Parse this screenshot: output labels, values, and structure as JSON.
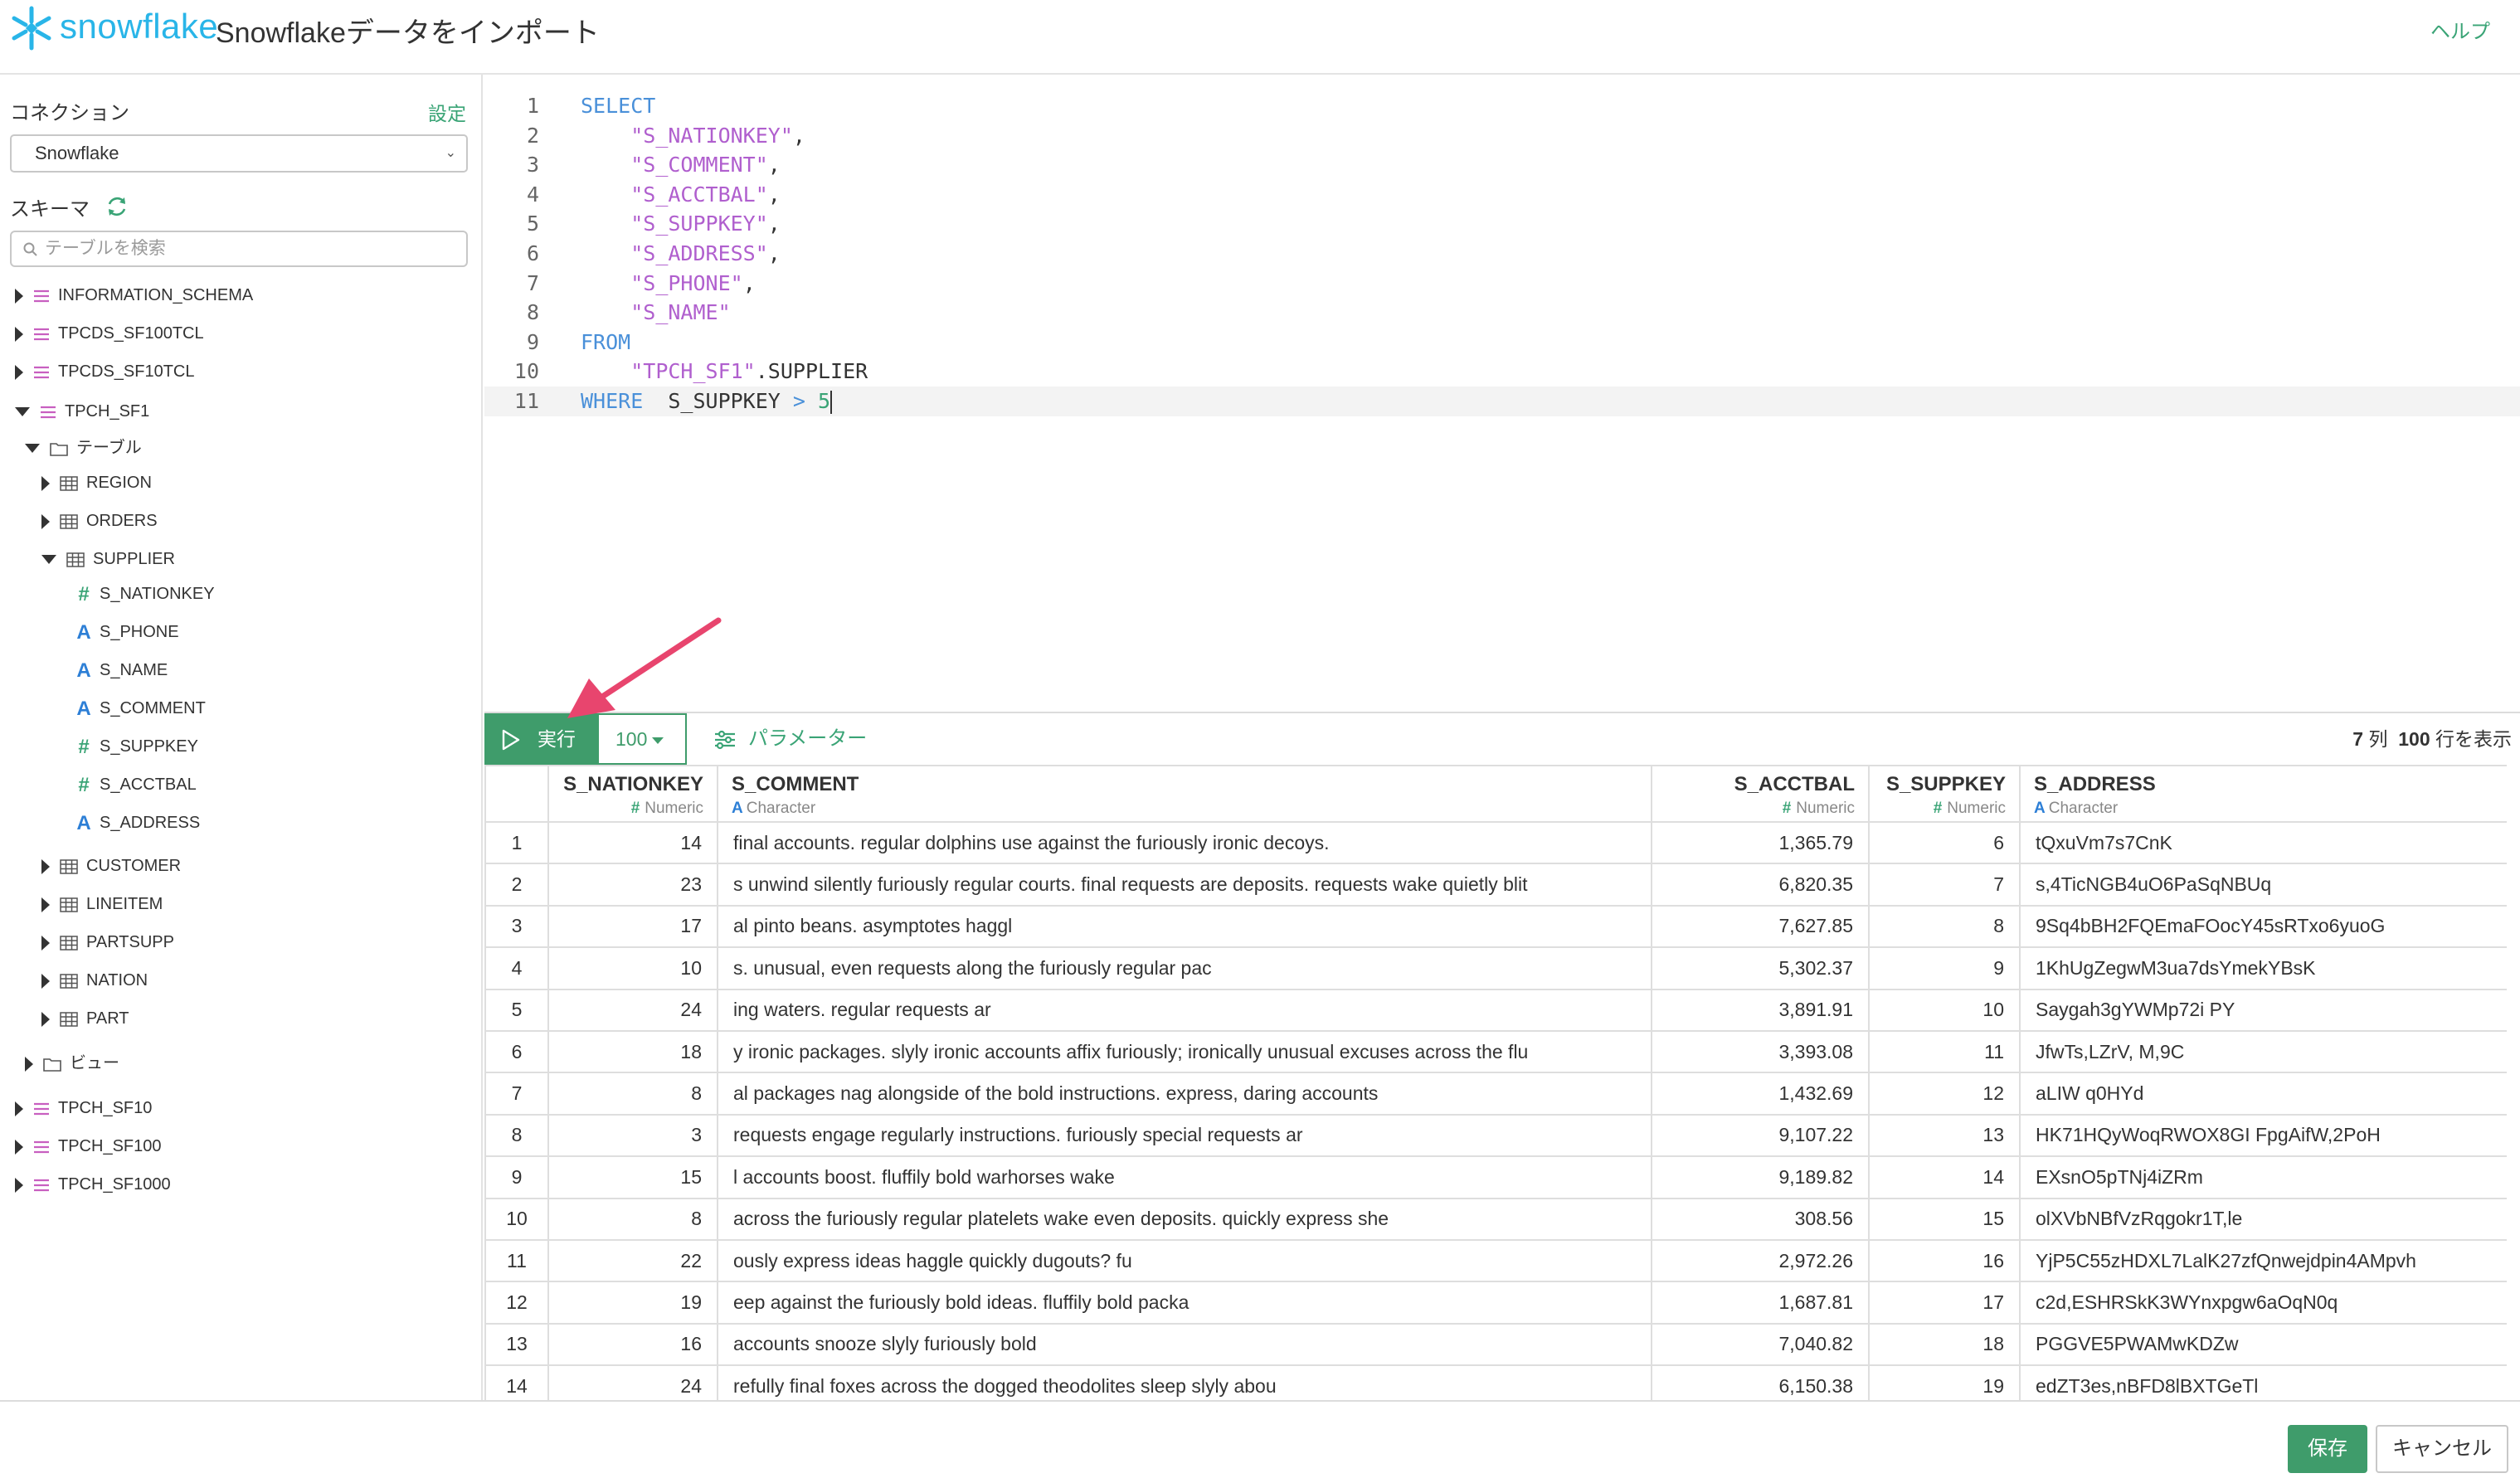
{
  "header": {
    "logo_text": "snowflake",
    "page_title": "Snowflakeデータをインポート",
    "help_label": "ヘルプ"
  },
  "sidebar": {
    "connection_label": "コネクション",
    "settings_label": "設定",
    "connection_value": "Snowflake",
    "schema_label": "スキーマ",
    "search_placeholder": "テーブルを検索",
    "tree": [
      {
        "label": "INFORMATION_SCHEMA",
        "kind": "schema",
        "expanded": false
      },
      {
        "label": "TPCDS_SF100TCL",
        "kind": "schema",
        "expanded": false
      },
      {
        "label": "TPCDS_SF10TCL",
        "kind": "schema",
        "expanded": false
      },
      {
        "label": "TPCH_SF1",
        "kind": "schema",
        "expanded": true
      },
      {
        "label": "テーブル",
        "kind": "folder",
        "expanded": true
      },
      {
        "label": "REGION",
        "kind": "table",
        "expanded": false
      },
      {
        "label": "ORDERS",
        "kind": "table",
        "expanded": false
      },
      {
        "label": "SUPPLIER",
        "kind": "table",
        "expanded": true
      },
      {
        "label": "S_NATIONKEY",
        "kind": "numeric"
      },
      {
        "label": "S_PHONE",
        "kind": "character"
      },
      {
        "label": "S_NAME",
        "kind": "character"
      },
      {
        "label": "S_COMMENT",
        "kind": "character"
      },
      {
        "label": "S_SUPPKEY",
        "kind": "numeric"
      },
      {
        "label": "S_ACCTBAL",
        "kind": "numeric"
      },
      {
        "label": "S_ADDRESS",
        "kind": "character"
      },
      {
        "label": "CUSTOMER",
        "kind": "table",
        "expanded": false
      },
      {
        "label": "LINEITEM",
        "kind": "table",
        "expanded": false
      },
      {
        "label": "PARTSUPP",
        "kind": "table",
        "expanded": false
      },
      {
        "label": "NATION",
        "kind": "table",
        "expanded": false
      },
      {
        "label": "PART",
        "kind": "table",
        "expanded": false
      },
      {
        "label": "ビュー",
        "kind": "folder",
        "expanded": false
      },
      {
        "label": "TPCH_SF10",
        "kind": "schema",
        "expanded": false
      },
      {
        "label": "TPCH_SF100",
        "kind": "schema",
        "expanded": false
      },
      {
        "label": "TPCH_SF1000",
        "kind": "schema",
        "expanded": false
      }
    ]
  },
  "editor": {
    "line_numbers": [
      "1",
      "2",
      "3",
      "4",
      "5",
      "6",
      "7",
      "8",
      "9",
      "10",
      "11"
    ],
    "lines": [
      [
        {
          "t": "SELECT",
          "c": "kw"
        }
      ],
      [
        {
          "t": "    ",
          "c": ""
        },
        {
          "t": "\"S_NATIONKEY\"",
          "c": "str"
        },
        {
          "t": ",",
          "c": ""
        }
      ],
      [
        {
          "t": "    ",
          "c": ""
        },
        {
          "t": "\"S_COMMENT\"",
          "c": "str"
        },
        {
          "t": ",",
          "c": ""
        }
      ],
      [
        {
          "t": "    ",
          "c": ""
        },
        {
          "t": "\"S_ACCTBAL\"",
          "c": "str"
        },
        {
          "t": ",",
          "c": ""
        }
      ],
      [
        {
          "t": "    ",
          "c": ""
        },
        {
          "t": "\"S_SUPPKEY\"",
          "c": "str"
        },
        {
          "t": ",",
          "c": ""
        }
      ],
      [
        {
          "t": "    ",
          "c": ""
        },
        {
          "t": "\"S_ADDRESS\"",
          "c": "str"
        },
        {
          "t": ",",
          "c": ""
        }
      ],
      [
        {
          "t": "    ",
          "c": ""
        },
        {
          "t": "\"S_PHONE\"",
          "c": "str"
        },
        {
          "t": ",",
          "c": ""
        }
      ],
      [
        {
          "t": "    ",
          "c": ""
        },
        {
          "t": "\"S_NAME\"",
          "c": "str"
        }
      ],
      [
        {
          "t": "FROM",
          "c": "kw"
        }
      ],
      [
        {
          "t": "    ",
          "c": ""
        },
        {
          "t": "\"TPCH_SF1\"",
          "c": "str"
        },
        {
          "t": ".SUPPLIER",
          "c": ""
        }
      ],
      [
        {
          "t": "WHERE",
          "c": "kw"
        },
        {
          "t": "  S_SUPPKEY ",
          "c": ""
        },
        {
          "t": ">",
          "c": "op"
        },
        {
          "t": " ",
          "c": ""
        },
        {
          "t": "5",
          "c": "num"
        }
      ]
    ]
  },
  "toolbar": {
    "run_label": "実行",
    "limit_value": "100",
    "params_label": "パラメーター",
    "col_count": "7",
    "col_unit": "列",
    "row_count": "100",
    "row_unit": "行を表示"
  },
  "results": {
    "columns": [
      {
        "name": "S_NATIONKEY",
        "type": "Numeric",
        "align": "right"
      },
      {
        "name": "S_COMMENT",
        "type": "Character",
        "align": "left"
      },
      {
        "name": "S_ACCTBAL",
        "type": "Numeric",
        "align": "right"
      },
      {
        "name": "S_SUPPKEY",
        "type": "Numeric",
        "align": "right"
      },
      {
        "name": "S_ADDRESS",
        "type": "Character",
        "align": "left"
      }
    ],
    "rows": [
      [
        "1",
        "14",
        "final accounts. regular dolphins use against the furiously ironic decoys.",
        "1,365.79",
        "6",
        "tQxuVm7s7CnK"
      ],
      [
        "2",
        "23",
        "s unwind silently furiously regular courts. final requests are deposits. requests wake quietly blit",
        "6,820.35",
        "7",
        "s,4TicNGB4uO6PaSqNBUq"
      ],
      [
        "3",
        "17",
        "al pinto beans. asymptotes haggl",
        "7,627.85",
        "8",
        "9Sq4bBH2FQEmaFOocY45sRTxo6yuoG"
      ],
      [
        "4",
        "10",
        "s. unusual, even requests along the furiously regular pac",
        "5,302.37",
        "9",
        "1KhUgZegwM3ua7dsYmekYBsK"
      ],
      [
        "5",
        "24",
        "ing waters. regular requests ar",
        "3,891.91",
        "10",
        "Saygah3gYWMp72i PY"
      ],
      [
        "6",
        "18",
        "y ironic packages. slyly ironic accounts affix furiously; ironically unusual excuses across the flu",
        "3,393.08",
        "11",
        "JfwTs,LZrV, M,9C"
      ],
      [
        "7",
        "8",
        "al packages nag alongside of the bold instructions. express, daring accounts",
        "1,432.69",
        "12",
        "aLIW  q0HYd"
      ],
      [
        "8",
        "3",
        "requests engage regularly instructions. furiously special requests ar",
        "9,107.22",
        "13",
        "HK71HQyWoqRWOX8GI FpgAifW,2PoH"
      ],
      [
        "9",
        "15",
        "l accounts boost. fluffily bold warhorses wake",
        "9,189.82",
        "14",
        "EXsnO5pTNj4iZRm"
      ],
      [
        "10",
        "8",
        " across the furiously regular platelets wake even deposits. quickly express she",
        "308.56",
        "15",
        "olXVbNBfVzRqgokr1T,le"
      ],
      [
        "11",
        "22",
        "ously express ideas haggle quickly dugouts? fu",
        "2,972.26",
        "16",
        "YjP5C55zHDXL7LalK27zfQnwejdpin4AMpvh"
      ],
      [
        "12",
        "19",
        "eep against the furiously bold ideas. fluffily bold packa",
        "1,687.81",
        "17",
        "c2d,ESHRSkK3WYnxpgw6aOqN0q"
      ],
      [
        "13",
        "16",
        "accounts snooze slyly furiously bold",
        "7,040.82",
        "18",
        "PGGVE5PWAMwKDZw"
      ],
      [
        "14",
        "24",
        "refully final foxes across the dogged theodolites sleep slyly abou",
        "6,150.38",
        "19",
        "edZT3es,nBFD8lBXTGeTl"
      ]
    ]
  },
  "footer": {
    "save_label": "保存",
    "cancel_label": "キャンセル"
  },
  "colors": {
    "brand": "#29b5e8",
    "accent_green": "#3f9c6b",
    "link_green": "#3aa476",
    "keyword_blue": "#4a90d9",
    "string_purple": "#b05fce",
    "schema_pink": "#c85fc0",
    "character_blue": "#2d7fd6",
    "annotation_arrow": "#e8456e"
  },
  "icons": {
    "logo": "snowflake-logo-icon",
    "refresh": "refresh-icon",
    "search": "search-icon",
    "schema": "schema-list-icon",
    "folder": "folder-icon",
    "table": "table-grid-icon",
    "run": "play-icon",
    "params": "sliders-icon"
  }
}
